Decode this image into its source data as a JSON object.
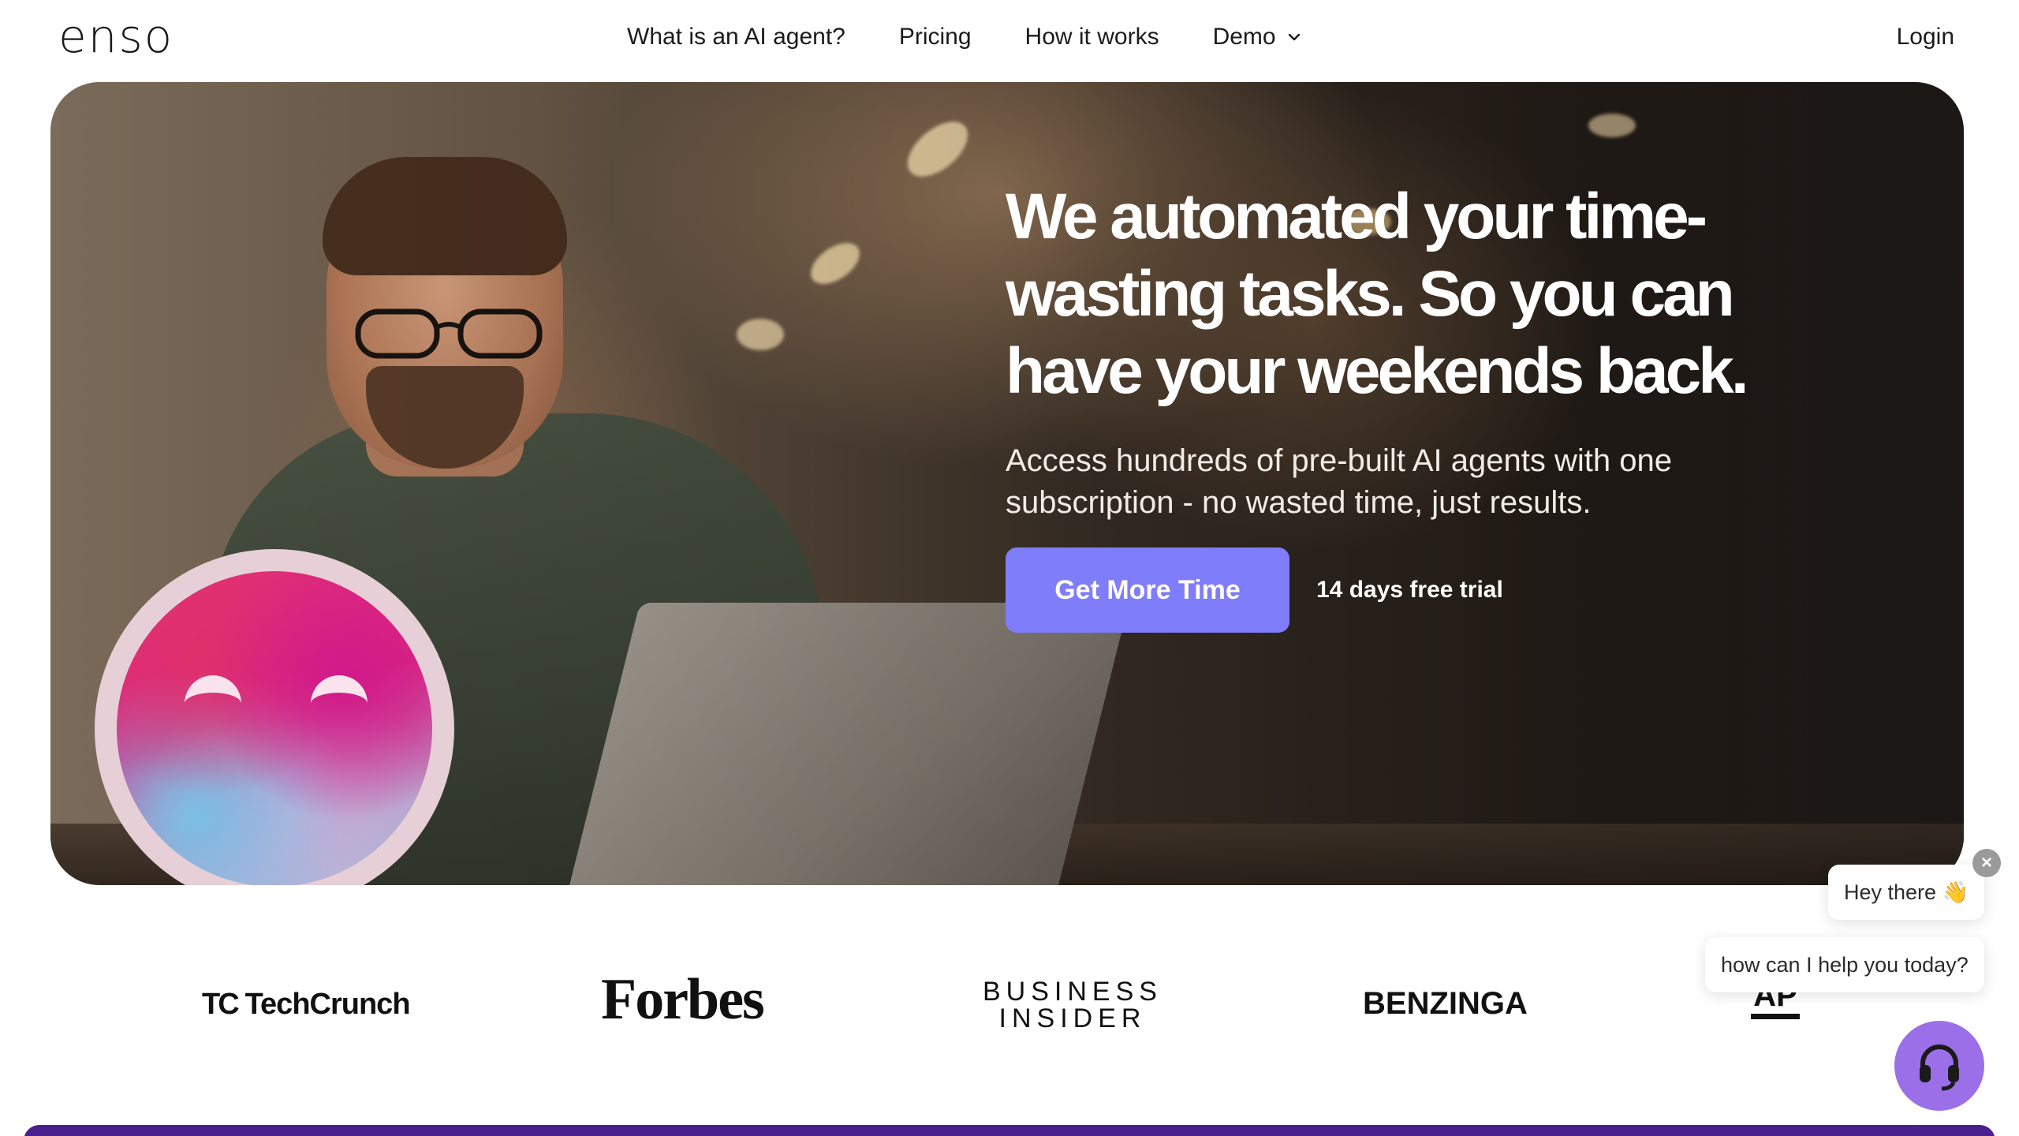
{
  "nav": {
    "logo": "enso",
    "links": [
      "What is an AI agent?",
      "Pricing",
      "How it works",
      "Demo"
    ],
    "login": "Login"
  },
  "hero": {
    "title": "We automated your time-wasting tasks. So you can have your weekends back.",
    "subtitle": "Access hundreds of pre-built AI agents with one subscription - no wasted time, just results.",
    "cta": "Get More Time",
    "trial_note": "14 days free trial"
  },
  "press_logos": {
    "techcrunch_mark": "TC",
    "techcrunch": "TechCrunch",
    "forbes": "Forbes",
    "business_insider_1": "BUSINESS",
    "business_insider_2": "INSIDER",
    "benzinga": "BENZINGA",
    "ap": "AP"
  },
  "chat": {
    "greeting": "Hey there 👋",
    "prompt": "how can I help you today?",
    "close": "×"
  },
  "colors": {
    "cta_bg": "#7f7dfa",
    "chat_button": "#9a6fe8",
    "bottom_band": "#4a1f8e"
  }
}
